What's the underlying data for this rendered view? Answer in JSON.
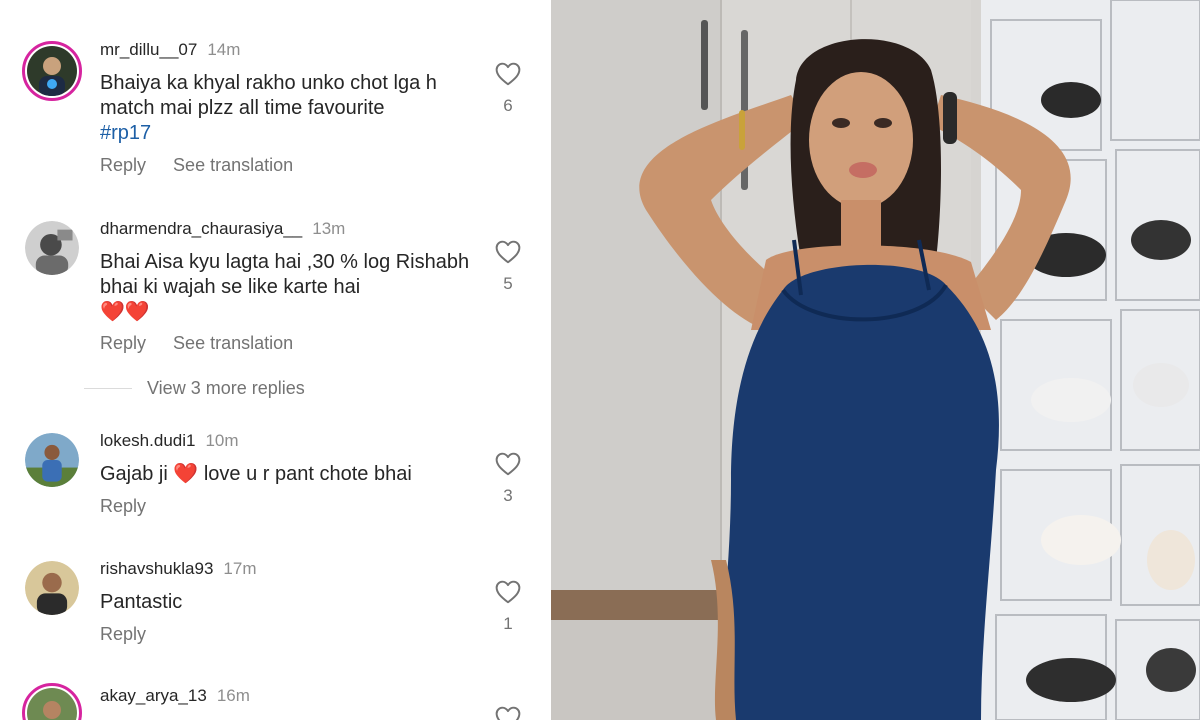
{
  "comments": [
    {
      "username": "mr_dillu__07",
      "time": "14m",
      "text": "Bhaiya ka khyal rakho unko chot lga h match mai plzz  all time favourite",
      "hashtag": "#rp17",
      "likes": "6",
      "reply_label": "Reply",
      "translate_label": "See translation"
    },
    {
      "username": "dharmendra_chaurasiya__",
      "time": "13m",
      "text": "Bhai Aisa kyu lagta hai ,30 % log Rishabh bhai ki wajah se like karte hai",
      "emoji": "❤️❤️",
      "likes": "5",
      "reply_label": "Reply",
      "translate_label": "See translation"
    },
    {
      "username": "lokesh.dudi1",
      "time": "10m",
      "text_before": "Gajab ji",
      "emoji": "❤️",
      "text_after": "love u r pant chote bhai",
      "likes": "3",
      "reply_label": "Reply"
    },
    {
      "username": "rishavshukla93",
      "time": "17m",
      "text": "Pantastic",
      "likes": "1",
      "reply_label": "Reply"
    },
    {
      "username": "akay_arya_13",
      "time": "16m"
    }
  ],
  "view_more_replies": "View 3 more replies",
  "colors": {
    "text": "#262626",
    "muted": "#737373",
    "hashtag": "#1d5fa6",
    "story_ring": "#d6249f",
    "heart": "#e0242f"
  }
}
